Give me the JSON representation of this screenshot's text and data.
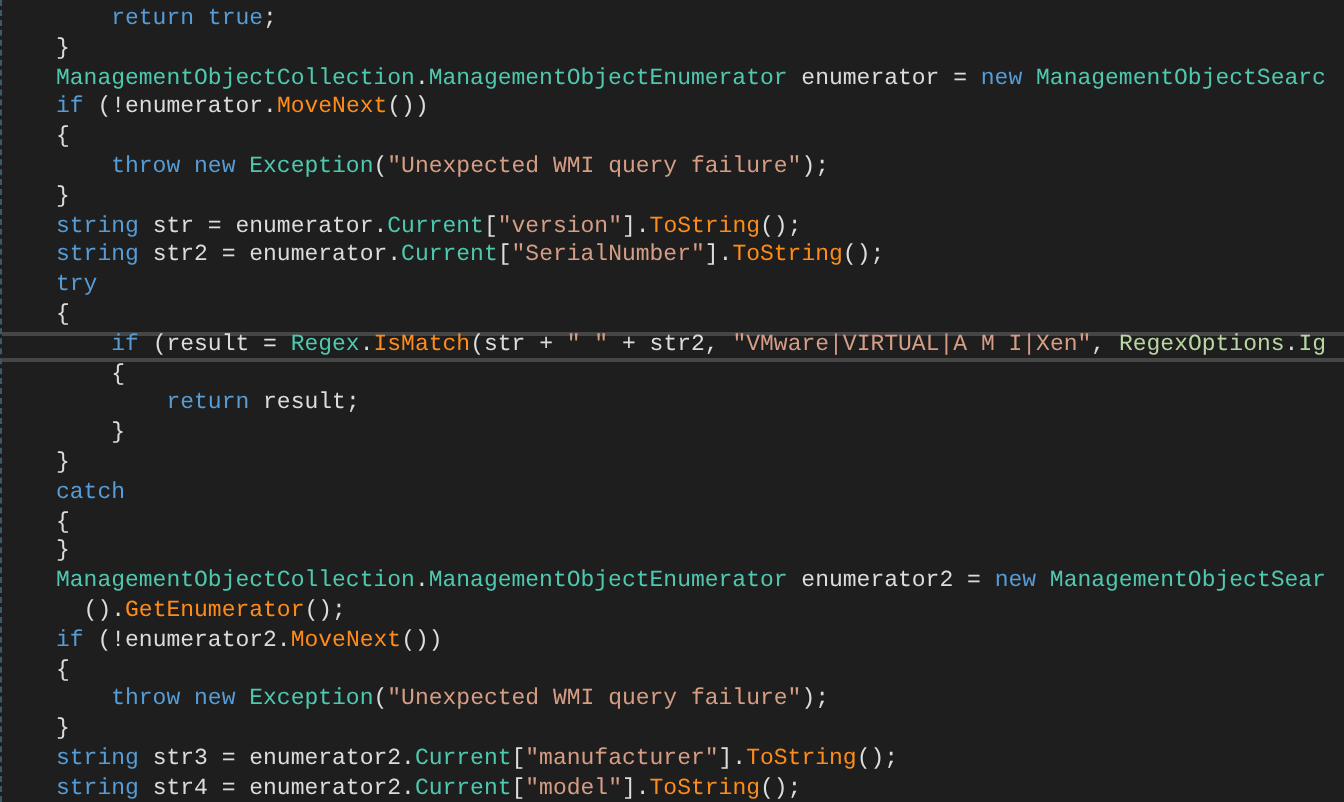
{
  "lines": [
    {
      "current": false,
      "tokens": [
        {
          "text": "    return true",
          "kind": "keyword"
        },
        {
          "text": ";",
          "kind": "plain"
        }
      ]
    },
    {
      "current": false,
      "tokens": [
        {
          "text": "}",
          "kind": "plain"
        }
      ]
    },
    {
      "current": false,
      "tokens": [
        {
          "text": "ManagementObjectCollection",
          "kind": "type"
        },
        {
          "text": ".",
          "kind": "plain"
        },
        {
          "text": "ManagementObjectEnumerator",
          "kind": "type"
        },
        {
          "text": " enumerator = ",
          "kind": "plain"
        },
        {
          "text": "new ",
          "kind": "keyword"
        },
        {
          "text": "ManagementObjectSearc",
          "kind": "type"
        }
      ]
    },
    {
      "current": false,
      "tokens": [
        {
          "text": "if ",
          "kind": "keyword"
        },
        {
          "text": "(!enumerator.",
          "kind": "plain"
        },
        {
          "text": "MoveNext",
          "kind": "method"
        },
        {
          "text": "())",
          "kind": "plain"
        }
      ]
    },
    {
      "current": false,
      "tokens": [
        {
          "text": "{",
          "kind": "plain"
        }
      ]
    },
    {
      "current": false,
      "tokens": [
        {
          "text": "    throw new ",
          "kind": "keyword"
        },
        {
          "text": "Exception",
          "kind": "type"
        },
        {
          "text": "(",
          "kind": "plain"
        },
        {
          "text": "\"Unexpected WMI query failure\"",
          "kind": "string"
        },
        {
          "text": ");",
          "kind": "plain"
        }
      ]
    },
    {
      "current": false,
      "tokens": [
        {
          "text": "}",
          "kind": "plain"
        }
      ]
    },
    {
      "current": false,
      "tokens": [
        {
          "text": "string ",
          "kind": "keyword"
        },
        {
          "text": "str = enumerator.",
          "kind": "plain"
        },
        {
          "text": "Current",
          "kind": "type"
        },
        {
          "text": "[",
          "kind": "plain"
        },
        {
          "text": "\"version\"",
          "kind": "string"
        },
        {
          "text": "].",
          "kind": "plain"
        },
        {
          "text": "ToString",
          "kind": "method"
        },
        {
          "text": "();",
          "kind": "plain"
        }
      ]
    },
    {
      "current": false,
      "tokens": [
        {
          "text": "string ",
          "kind": "keyword"
        },
        {
          "text": "str2 = enumerator.",
          "kind": "plain"
        },
        {
          "text": "Current",
          "kind": "type"
        },
        {
          "text": "[",
          "kind": "plain"
        },
        {
          "text": "\"SerialNumber\"",
          "kind": "string"
        },
        {
          "text": "].",
          "kind": "plain"
        },
        {
          "text": "ToString",
          "kind": "method"
        },
        {
          "text": "();",
          "kind": "plain"
        }
      ]
    },
    {
      "current": false,
      "tokens": [
        {
          "text": "try",
          "kind": "keyword"
        }
      ]
    },
    {
      "current": false,
      "tokens": [
        {
          "text": "{",
          "kind": "plain"
        }
      ]
    },
    {
      "current": true,
      "tokens": [
        {
          "text": "    if ",
          "kind": "keyword"
        },
        {
          "text": "(result = ",
          "kind": "plain"
        },
        {
          "text": "Regex",
          "kind": "type"
        },
        {
          "text": ".",
          "kind": "plain"
        },
        {
          "text": "IsMatch",
          "kind": "method"
        },
        {
          "text": "(str + ",
          "kind": "plain"
        },
        {
          "text": "\" \"",
          "kind": "string"
        },
        {
          "text": " + str2, ",
          "kind": "plain"
        },
        {
          "text": "\"VMware|VIRTUAL|A M I|Xen\"",
          "kind": "string"
        },
        {
          "text": ", ",
          "kind": "plain"
        },
        {
          "text": "RegexOptions",
          "kind": "enum"
        },
        {
          "text": ".",
          "kind": "plain"
        },
        {
          "text": "Ig",
          "kind": "enum"
        }
      ]
    },
    {
      "current": false,
      "tokens": [
        {
          "text": "    {",
          "kind": "plain"
        }
      ]
    },
    {
      "current": false,
      "tokens": [
        {
          "text": "        return ",
          "kind": "keyword"
        },
        {
          "text": "result;",
          "kind": "plain"
        }
      ]
    },
    {
      "current": false,
      "tokens": [
        {
          "text": "    }",
          "kind": "plain"
        }
      ]
    },
    {
      "current": false,
      "tokens": [
        {
          "text": "}",
          "kind": "plain"
        }
      ]
    },
    {
      "current": false,
      "tokens": [
        {
          "text": "catch",
          "kind": "keyword"
        }
      ]
    },
    {
      "current": false,
      "tokens": [
        {
          "text": "{",
          "kind": "plain"
        }
      ]
    },
    {
      "current": false,
      "tokens": [
        {
          "text": "}",
          "kind": "plain"
        }
      ]
    },
    {
      "current": false,
      "tokens": [
        {
          "text": "ManagementObjectCollection",
          "kind": "type"
        },
        {
          "text": ".",
          "kind": "plain"
        },
        {
          "text": "ManagementObjectEnumerator",
          "kind": "type"
        },
        {
          "text": " enumerator2 = ",
          "kind": "plain"
        },
        {
          "text": "new ",
          "kind": "keyword"
        },
        {
          "text": "ManagementObjectSear",
          "kind": "type"
        }
      ]
    },
    {
      "current": false,
      "tokens": [
        {
          "text": "  ().",
          "kind": "plain"
        },
        {
          "text": "GetEnumerator",
          "kind": "method"
        },
        {
          "text": "();",
          "kind": "plain"
        }
      ]
    },
    {
      "current": false,
      "tokens": [
        {
          "text": "if ",
          "kind": "keyword"
        },
        {
          "text": "(!enumerator2.",
          "kind": "plain"
        },
        {
          "text": "MoveNext",
          "kind": "method"
        },
        {
          "text": "())",
          "kind": "plain"
        }
      ]
    },
    {
      "current": false,
      "tokens": [
        {
          "text": "{",
          "kind": "plain"
        }
      ]
    },
    {
      "current": false,
      "tokens": [
        {
          "text": "    throw new ",
          "kind": "keyword"
        },
        {
          "text": "Exception",
          "kind": "type"
        },
        {
          "text": "(",
          "kind": "plain"
        },
        {
          "text": "\"Unexpected WMI query failure\"",
          "kind": "string"
        },
        {
          "text": ");",
          "kind": "plain"
        }
      ]
    },
    {
      "current": false,
      "tokens": [
        {
          "text": "}",
          "kind": "plain"
        }
      ]
    },
    {
      "current": false,
      "tokens": [
        {
          "text": "string ",
          "kind": "keyword"
        },
        {
          "text": "str3 = enumerator2.",
          "kind": "plain"
        },
        {
          "text": "Current",
          "kind": "type"
        },
        {
          "text": "[",
          "kind": "plain"
        },
        {
          "text": "\"manufacturer\"",
          "kind": "string"
        },
        {
          "text": "].",
          "kind": "plain"
        },
        {
          "text": "ToString",
          "kind": "method"
        },
        {
          "text": "();",
          "kind": "plain"
        }
      ]
    },
    {
      "current": false,
      "tokens": [
        {
          "text": "string ",
          "kind": "keyword"
        },
        {
          "text": "str4 = enumerator2.",
          "kind": "plain"
        },
        {
          "text": "Current",
          "kind": "type"
        },
        {
          "text": "[",
          "kind": "plain"
        },
        {
          "text": "\"model\"",
          "kind": "string"
        },
        {
          "text": "].",
          "kind": "plain"
        },
        {
          "text": "ToString",
          "kind": "method"
        },
        {
          "text": "();",
          "kind": "plain"
        }
      ]
    }
  ]
}
